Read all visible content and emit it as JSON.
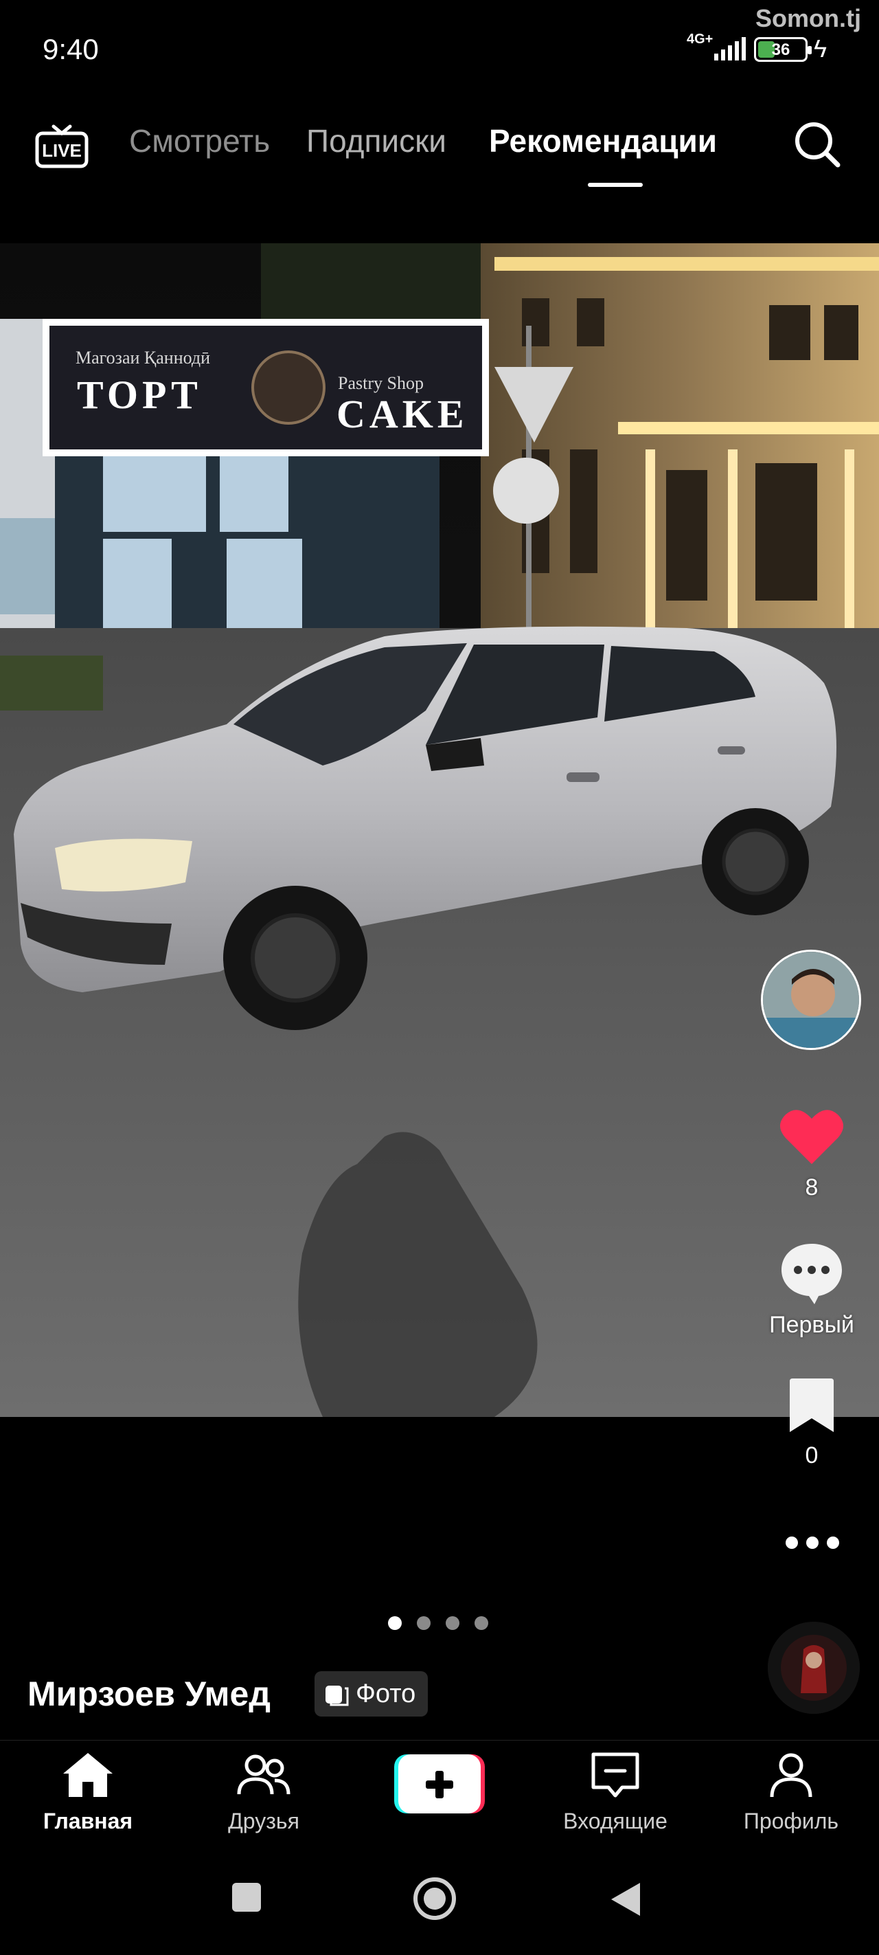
{
  "status_bar": {
    "time": "9:40",
    "network": "4G+",
    "battery": "36",
    "battery_level": 0.36,
    "watermark": "Somon.tj"
  },
  "top_nav": {
    "live_label": "LIVE",
    "tabs": [
      {
        "label": "Смотреть"
      },
      {
        "label": "Подписки"
      },
      {
        "label": "Рекомендации",
        "active": true
      }
    ]
  },
  "photo": {
    "sign_left_small": "Магозаи Қаннодӣ",
    "sign_left_big": "ТОРТ",
    "sign_right_small": "Pastry Shop",
    "sign_right_big": "CAKE"
  },
  "actions": {
    "likes": "8",
    "comments": "Первый",
    "saves": "0"
  },
  "carousel": {
    "count": 4,
    "active_index": 0
  },
  "post": {
    "author": "Мирзоев Умед",
    "type_badge": "Фото"
  },
  "tabbar": {
    "home": "Главная",
    "friends": "Друзья",
    "inbox": "Входящие",
    "profile": "Профиль"
  },
  "colors": {
    "like": "#fe2c55",
    "create_left": "#25f4ee",
    "create_right": "#fe2c55",
    "battery": "#4caf50"
  },
  "icons": [
    "live-icon",
    "search-icon",
    "heart-icon",
    "comment-icon",
    "bookmark-icon",
    "more-icon",
    "home-icon",
    "friends-icon",
    "plus-icon",
    "inbox-icon",
    "profile-icon",
    "recents-icon",
    "home-circle-icon",
    "back-icon"
  ]
}
